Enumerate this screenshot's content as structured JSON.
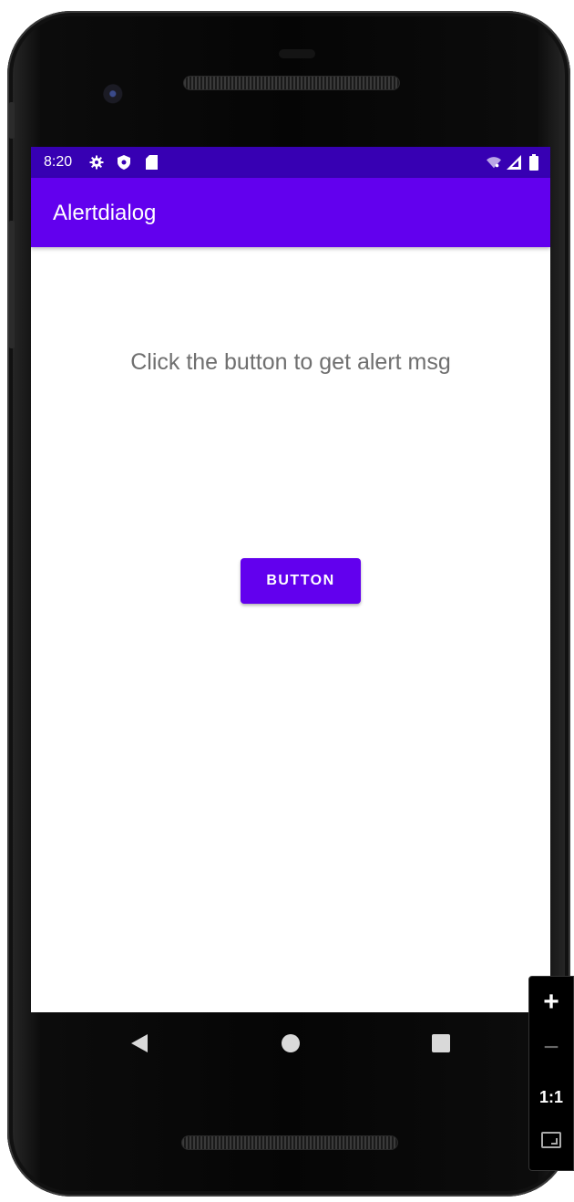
{
  "status_bar": {
    "time": "8:20",
    "icons": [
      "settings-icon",
      "shield-icon",
      "sd-card-icon"
    ],
    "right_icons": [
      "wifi-icon",
      "signal-icon",
      "battery-icon"
    ]
  },
  "app_bar": {
    "title": "Alertdialog"
  },
  "main": {
    "message": "Click the button to get alert msg",
    "button_label": "BUTTON"
  },
  "nav_bar": {
    "buttons": [
      "back",
      "home",
      "recents"
    ]
  },
  "zoom_controls": {
    "plus": "+",
    "minus": "−",
    "actual_size": "1:1"
  },
  "colors": {
    "primary": "#6200EE",
    "primary_dark": "#3700B3",
    "text_secondary": "#6f6f6f"
  }
}
